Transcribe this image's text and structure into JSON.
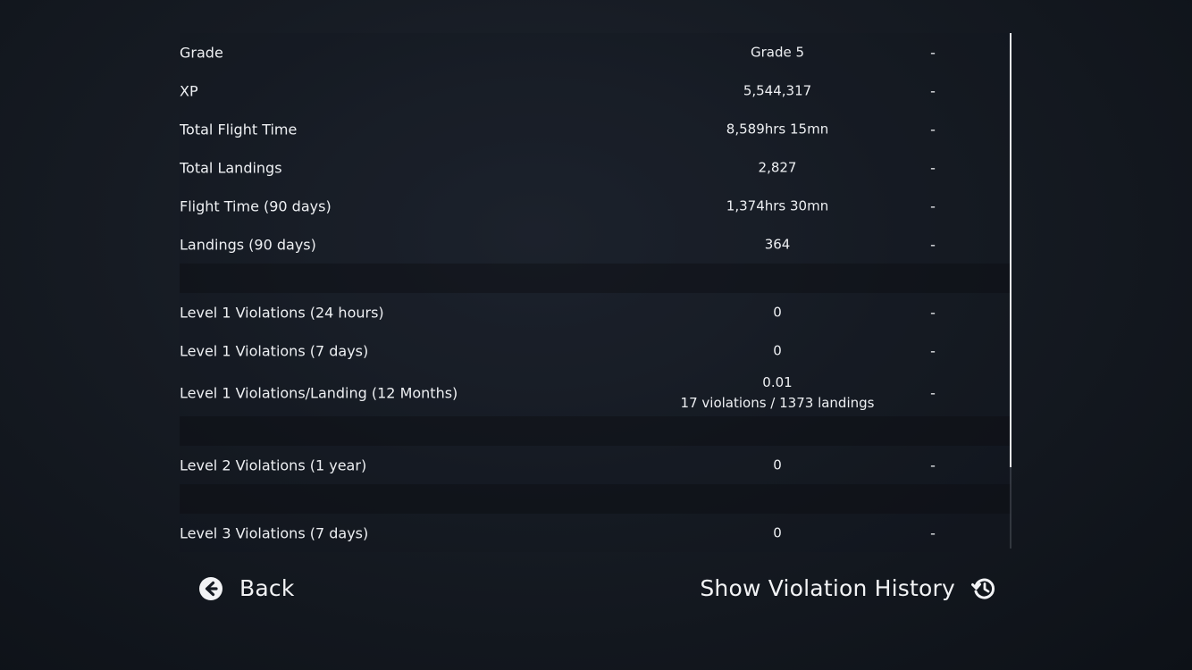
{
  "stats": {
    "rows": [
      {
        "label": "Grade",
        "value": "Grade 5",
        "value2": "",
        "extra": "-"
      },
      {
        "label": "XP",
        "value": "5,544,317",
        "value2": "",
        "extra": "-"
      },
      {
        "label": "Total Flight Time",
        "value": "8,589hrs 15mn",
        "value2": "",
        "extra": "-"
      },
      {
        "label": "Total Landings",
        "value": "2,827",
        "value2": "",
        "extra": "-"
      },
      {
        "label": "Flight Time (90 days)",
        "value": "1,374hrs 30mn",
        "value2": "",
        "extra": "-"
      },
      {
        "label": "Landings (90 days)",
        "value": "364",
        "value2": "",
        "extra": "-"
      },
      {
        "label": "Level 1 Violations (24 hours)",
        "value": "0",
        "value2": "",
        "extra": "-"
      },
      {
        "label": "Level 1 Violations (7 days)",
        "value": "0",
        "value2": "",
        "extra": "-"
      },
      {
        "label": "Level 1 Violations/Landing (12 Months)",
        "value": "0.01",
        "value2": "17 violations / 1373 landings",
        "extra": "-"
      },
      {
        "label": "Level 2 Violations (1 year)",
        "value": "0",
        "value2": "",
        "extra": "-"
      },
      {
        "label": "Level 3 Violations (7 days)",
        "value": "0",
        "value2": "",
        "extra": "-"
      }
    ]
  },
  "footer": {
    "back_label": "Back",
    "history_label": "Show Violation History",
    "back_icon": "arrow-left-circle-icon",
    "history_icon": "history-icon"
  },
  "colors": {
    "text": "#eef0f3",
    "background": "#161b23",
    "scrollbar_thumb": "#e9ebee"
  }
}
